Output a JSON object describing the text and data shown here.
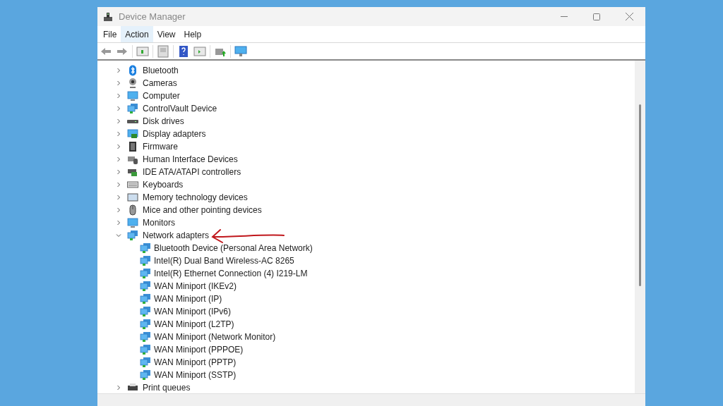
{
  "window": {
    "title": "Device Manager"
  },
  "menu": [
    {
      "label": "File",
      "selected": false
    },
    {
      "label": "Action",
      "selected": true
    },
    {
      "label": "View",
      "selected": false
    },
    {
      "label": "Help",
      "selected": false
    }
  ],
  "tree": [
    {
      "label": "Bluetooth",
      "expanded": false
    },
    {
      "label": "Cameras",
      "expanded": false
    },
    {
      "label": "Computer",
      "expanded": false
    },
    {
      "label": "ControlVault Device",
      "expanded": false
    },
    {
      "label": "Disk drives",
      "expanded": false
    },
    {
      "label": "Display adapters",
      "expanded": false
    },
    {
      "label": "Firmware",
      "expanded": false
    },
    {
      "label": "Human Interface Devices",
      "expanded": false
    },
    {
      "label": "IDE ATA/ATAPI controllers",
      "expanded": false
    },
    {
      "label": "Keyboards",
      "expanded": false
    },
    {
      "label": "Memory technology devices",
      "expanded": false
    },
    {
      "label": "Mice and other pointing devices",
      "expanded": false
    },
    {
      "label": "Monitors",
      "expanded": false
    },
    {
      "label": "Network adapters",
      "expanded": true,
      "children": [
        {
          "label": "Bluetooth Device (Personal Area Network)"
        },
        {
          "label": "Intel(R) Dual Band Wireless-AC 8265"
        },
        {
          "label": "Intel(R) Ethernet Connection (4) I219-LM"
        },
        {
          "label": "WAN Miniport (IKEv2)"
        },
        {
          "label": "WAN Miniport (IP)"
        },
        {
          "label": "WAN Miniport (IPv6)"
        },
        {
          "label": "WAN Miniport (L2TP)"
        },
        {
          "label": "WAN Miniport (Network Monitor)"
        },
        {
          "label": "WAN Miniport (PPPOE)"
        },
        {
          "label": "WAN Miniport (PPTP)"
        },
        {
          "label": "WAN Miniport (SSTP)"
        }
      ]
    },
    {
      "label": "Print queues",
      "expanded": false
    }
  ]
}
